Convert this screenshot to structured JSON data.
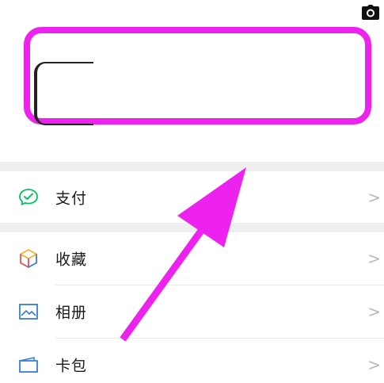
{
  "header": {
    "camera_icon": "camera-icon"
  },
  "profile": {
    "highlight_color": "#ee22ee"
  },
  "menu": [
    {
      "label": "支付",
      "icon": "wechat-pay-icon",
      "icon_color": "#07c160"
    },
    {
      "label": "收藏",
      "icon": "cube-icon",
      "icon_color": "#f0b429"
    },
    {
      "label": "相册",
      "icon": "image-icon",
      "icon_color": "#3a7bd5"
    },
    {
      "label": "卡包",
      "icon": "card-icon",
      "icon_color": "#3a7bd5"
    }
  ],
  "chevron": ">",
  "annotation": {
    "arrow_color": "#ee22ee"
  }
}
